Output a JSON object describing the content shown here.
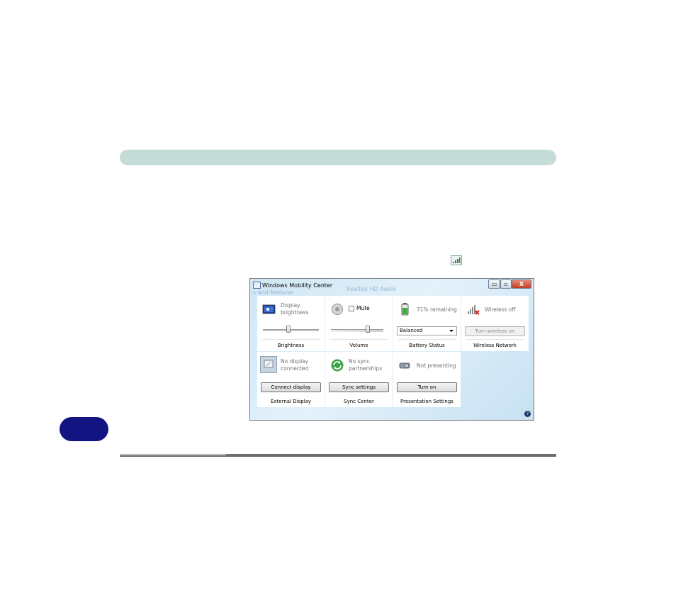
{
  "window": {
    "title": "Windows Mobility Center",
    "ghost_text_1": "Realtek HD Audio",
    "ghost_text_2": "s and features",
    "minimize_glyph": "▭",
    "maximize_glyph": "▫",
    "close_glyph": "X"
  },
  "tiles": {
    "brightness": {
      "text": "Display brightness",
      "caption": "Brightness",
      "slider_level": 0.45
    },
    "volume": {
      "mute_label": "Mute",
      "muted": false,
      "caption": "Volume",
      "slider_level": 0.7
    },
    "battery": {
      "text": "71% remaining",
      "plan": "Balanced",
      "caption": "Battery Status"
    },
    "wireless": {
      "text": "Wireless off",
      "button": "Turn wireless on",
      "caption": "Wireless Network"
    },
    "external_display": {
      "text": "No display connected",
      "button": "Connect display",
      "caption": "External Display"
    },
    "sync": {
      "text": "No sync partnerships",
      "button": "Sync settings",
      "caption": "Sync Center"
    },
    "presentation": {
      "text": "Not presenting",
      "button": "Turn on",
      "caption": "Presentation Settings"
    }
  },
  "icons": {
    "tray": "mobility-center-tray-icon",
    "help": "help-icon"
  },
  "colors": {
    "header_band": "#c5dcd8",
    "side_tab": "#121482",
    "close_button": "#c23d24"
  }
}
